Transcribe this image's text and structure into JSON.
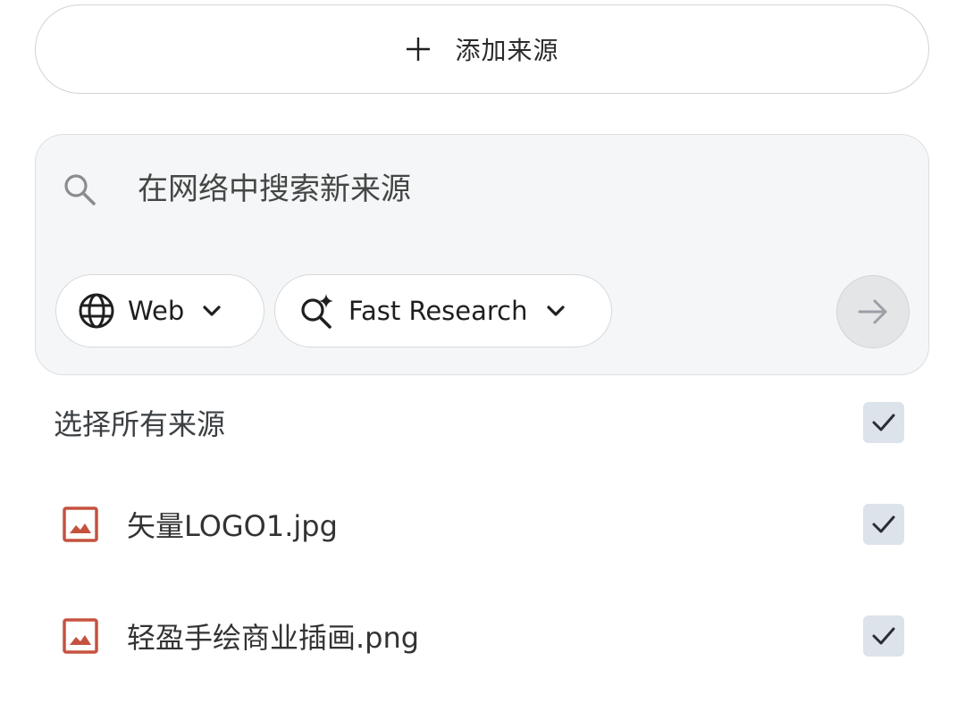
{
  "add_source": {
    "label": "添加来源",
    "icon": "plus-icon"
  },
  "search": {
    "placeholder": "在网络中搜索新来源",
    "icon": "search-icon",
    "source_chip": {
      "label": "Web",
      "icon": "globe-icon"
    },
    "mode_chip": {
      "label": "Fast Research",
      "icon": "search-sparkle-icon"
    },
    "submit_icon": "arrow-right-icon"
  },
  "select_all": {
    "label": "选择所有来源",
    "checked": true
  },
  "sources": [
    {
      "name": "矢量LOGO1.jpg",
      "icon": "image-icon",
      "checked": true
    },
    {
      "name": "轻盈手绘商业插画.png",
      "icon": "image-icon",
      "checked": true
    }
  ],
  "colors": {
    "file_icon": "#c5523f",
    "checkbox_bg": "#dde3ea",
    "panel_bg": "#f5f6f7"
  }
}
